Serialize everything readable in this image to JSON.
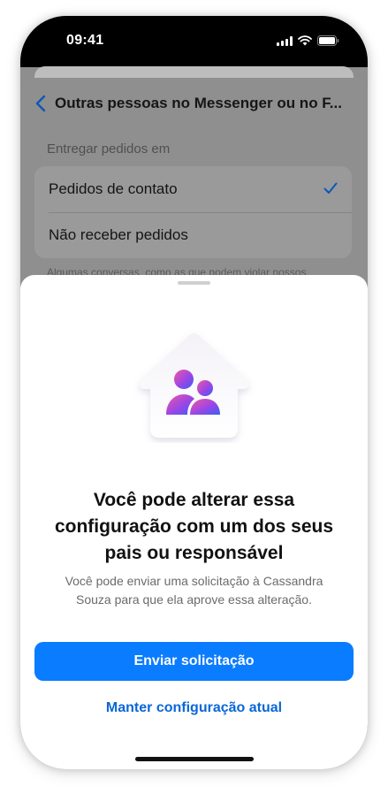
{
  "status_bar": {
    "time": "09:41"
  },
  "settings_screen": {
    "title": "Outras pessoas no Messenger ou no F...",
    "section_header": "Entregar pedidos em",
    "options": [
      {
        "label": "Pedidos de contato",
        "selected": true
      },
      {
        "label": "Não receber pedidos",
        "selected": false
      }
    ],
    "footer_note": "Algumas conversas, como as que podem violar nossos"
  },
  "sheet": {
    "illustration": "house-with-people-icon",
    "title_lines": [
      "Você pode alterar essa",
      "configuração com um dos seus",
      "pais ou responsável"
    ],
    "description_lines": [
      "Você pode enviar uma solicitação à Cassandra",
      "Souza para que ela aprove essa alteração."
    ],
    "primary_button": "Enviar solicitação",
    "secondary_button": "Manter configuração atual"
  },
  "colors": {
    "accent": "#0a7cff",
    "link": "#0a66d8"
  }
}
